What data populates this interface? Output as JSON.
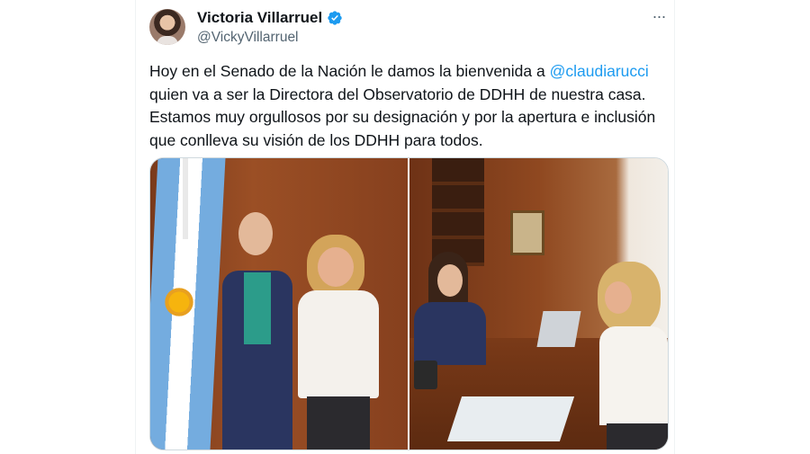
{
  "tweet": {
    "author_name": "Victoria Villarruel",
    "handle": "@VickyVillarruel",
    "more_label": "···",
    "text_lines": [
      {
        "before": "Hoy en el Senado de la Nación le damos la bienvenida a ",
        "mention": "@claudiarucci"
      },
      {
        "text": "quien va a ser la Directora del Observatorio de DDHH de nuestra casa."
      },
      {
        "text": "Estamos muy orgullosos por su designación y por la apertura e inclusión"
      },
      {
        "text": "que conlleva su visión de los DDHH para todos."
      }
    ],
    "media": [
      {
        "kind": "photo",
        "subject": "two women posing beside Argentine flag"
      },
      {
        "kind": "photo",
        "subject": "two women seated at a desk in an office"
      }
    ]
  },
  "colors": {
    "text": "#0f1419",
    "secondary": "#536471",
    "link": "#1d9bf0",
    "verified": "#1d9bf0",
    "border": "#cfd9de"
  },
  "icons": [
    "verified-badge-icon",
    "more-options-icon"
  ]
}
